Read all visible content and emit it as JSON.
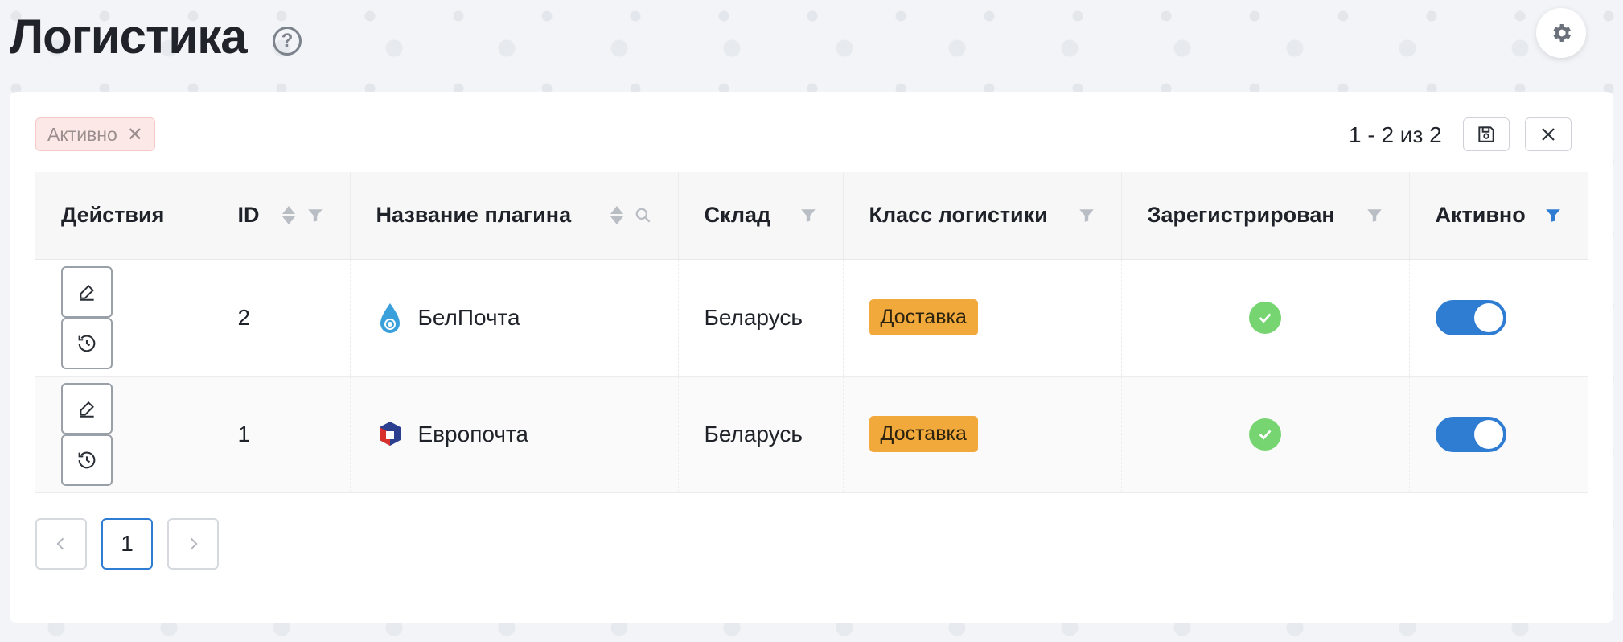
{
  "header": {
    "title": "Логистика",
    "help_icon": "help-circle-icon",
    "settings_icon": "gear-icon"
  },
  "toolbar": {
    "active_filter_label": "Активно",
    "range_text": "1 - 2 из 2",
    "save_icon": "save-icon",
    "close_icon": "close-icon"
  },
  "table": {
    "columns": [
      "Действия",
      "ID",
      "Название плагина",
      "Склад",
      "Класс логистики",
      "Зарегистрирован",
      "Активно"
    ],
    "rows": [
      {
        "id": "2",
        "plugin": "БелПочта",
        "warehouse": "Беларусь",
        "class": "Доставка",
        "registered": true,
        "active": true
      },
      {
        "id": "1",
        "plugin": "Европочта",
        "warehouse": "Беларусь",
        "class": "Доставка",
        "registered": true,
        "active": true
      }
    ]
  },
  "pagination": {
    "current_page": "1",
    "prev_icon": "chevron-left-icon",
    "next_icon": "chevron-right-icon"
  },
  "colors": {
    "accent": "#2f7dd3",
    "tag_delivery": "#f2a93b",
    "check_green": "#76d571",
    "filter_tag_bg": "#fde8e8"
  }
}
